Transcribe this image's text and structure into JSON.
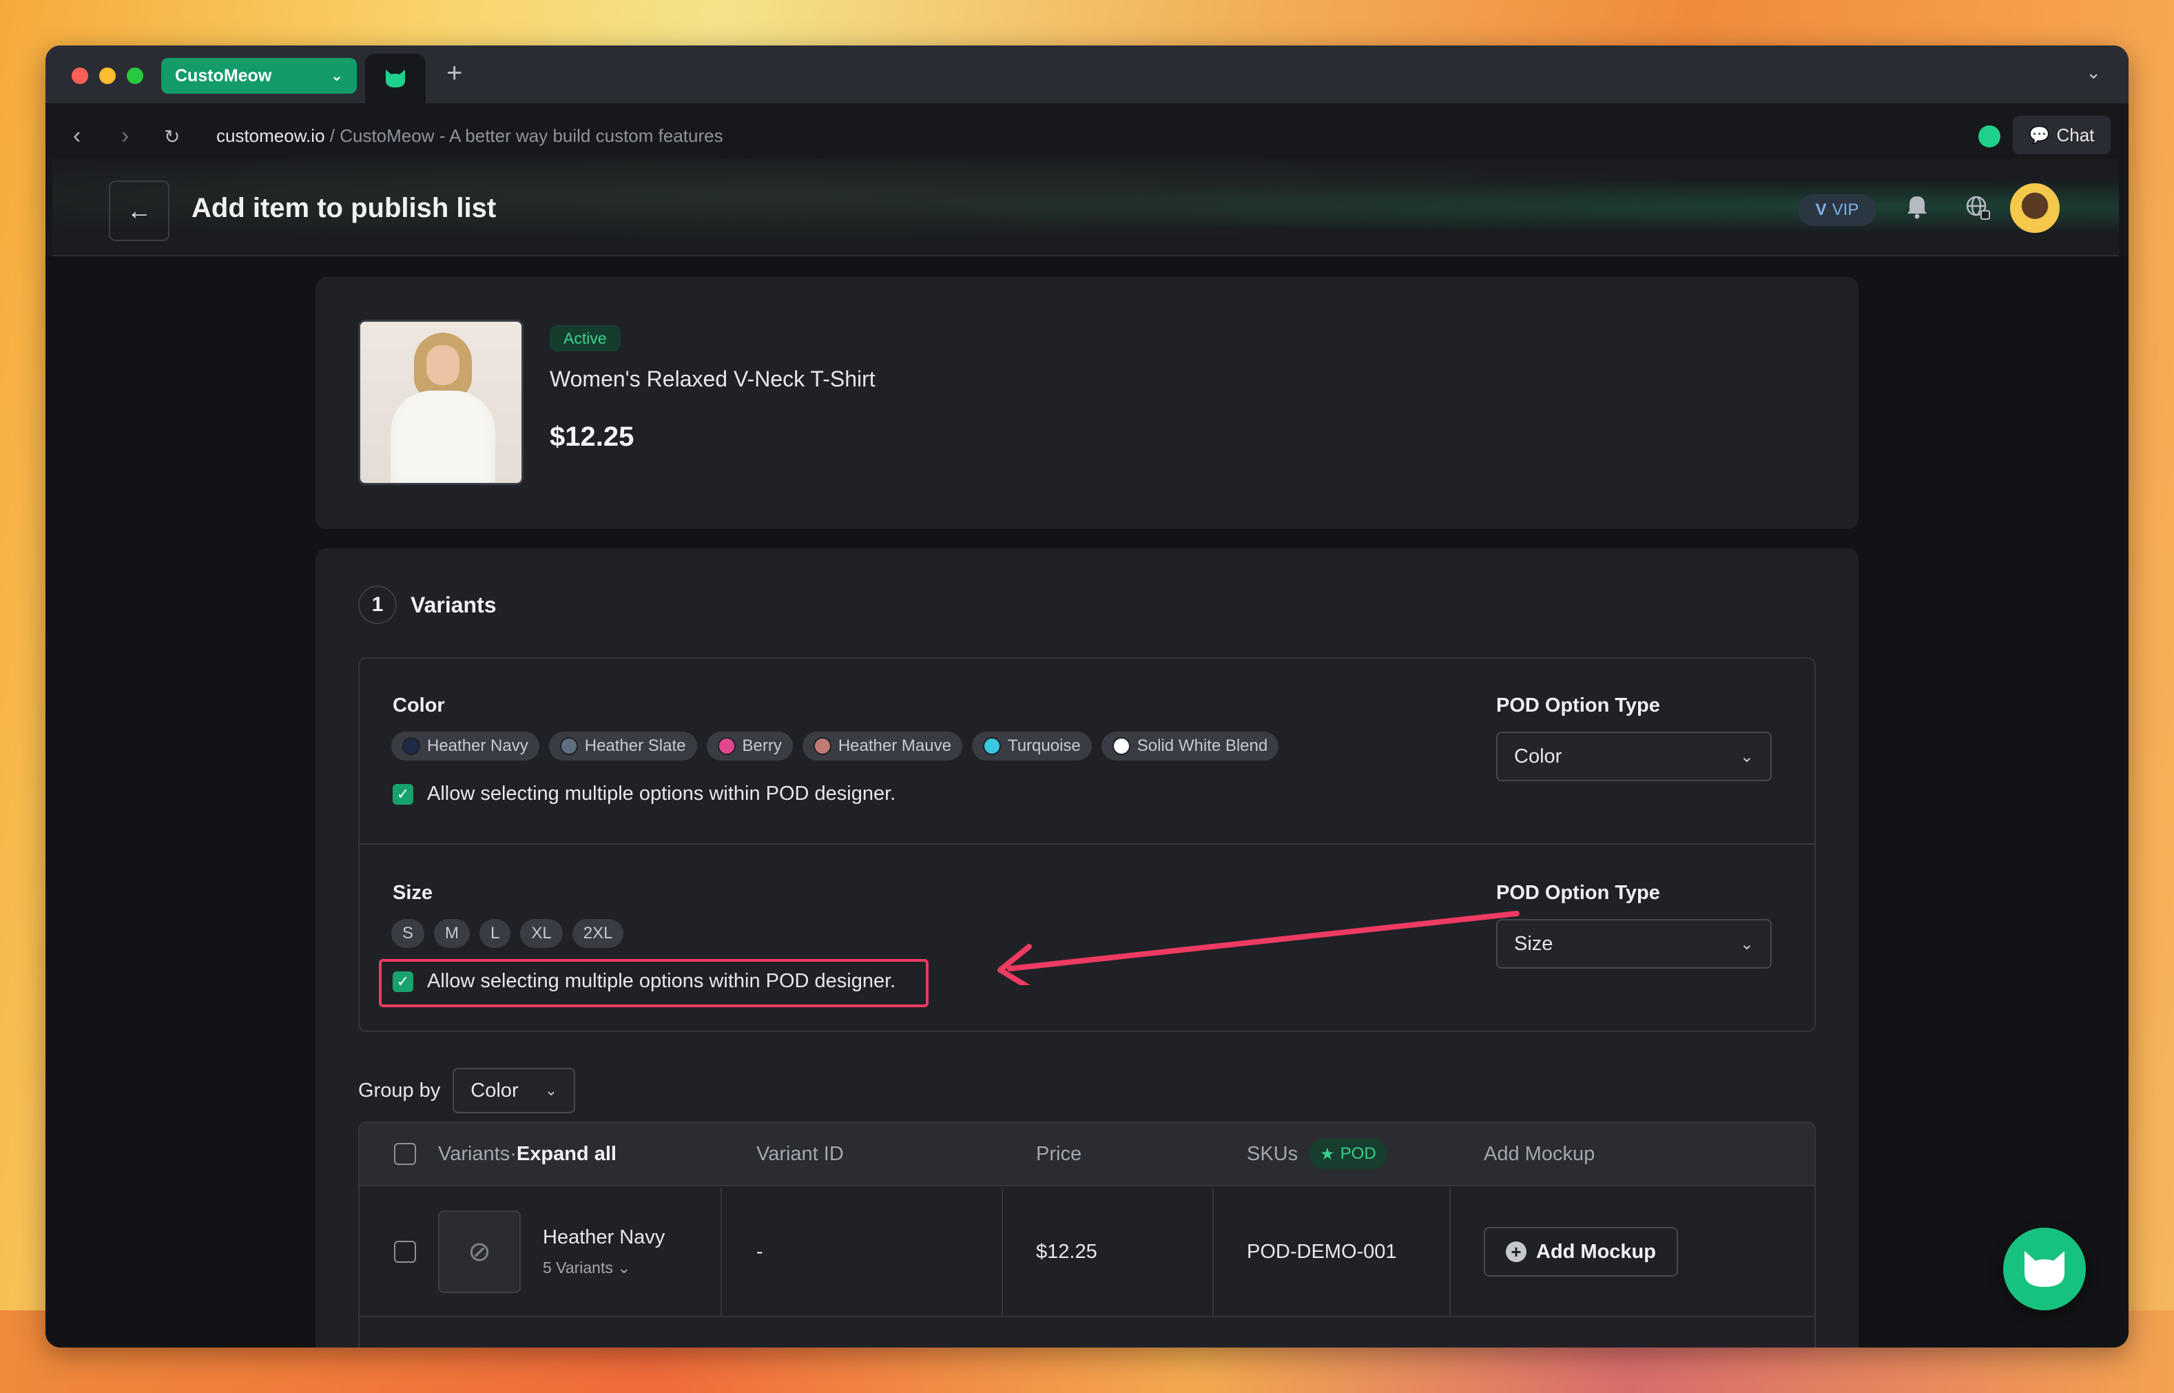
{
  "browser": {
    "workspace": "CustoMeow",
    "new_tab": "+",
    "url_domain": "customeow.io",
    "url_rest": " / CustoMeow - A better way build custom features",
    "chat_label": "Chat"
  },
  "header": {
    "title": "Add item to publish list",
    "vip_label": "VIP"
  },
  "product": {
    "status": "Active",
    "name": "Women's Relaxed V-Neck T-Shirt",
    "price": "$12.25"
  },
  "variants": {
    "step_number": "1",
    "step_label": "Variants",
    "options": [
      {
        "label": "Color",
        "values": [
          {
            "name": "Heather Navy",
            "color": "#1f2a4a"
          },
          {
            "name": "Heather Slate",
            "color": "#5d6f80"
          },
          {
            "name": "Berry",
            "color": "#e0468e"
          },
          {
            "name": "Heather Mauve",
            "color": "#c07a72"
          },
          {
            "name": "Turquoise",
            "color": "#39c8e0"
          },
          {
            "name": "Solid White Blend",
            "color": "#ffffff"
          }
        ],
        "allow_multiple": "Allow selecting multiple options within POD designer.",
        "pod_type_label": "POD Option Type",
        "pod_type_value": "Color"
      },
      {
        "label": "Size",
        "values": [
          {
            "name": "S"
          },
          {
            "name": "M"
          },
          {
            "name": "L"
          },
          {
            "name": "XL"
          },
          {
            "name": "2XL"
          }
        ],
        "allow_multiple": "Allow selecting multiple options within POD designer.",
        "pod_type_label": "POD Option Type",
        "pod_type_value": "Size"
      }
    ],
    "group_by_label": "Group by",
    "group_by_value": "Color"
  },
  "table": {
    "headers": {
      "variants": "Variants",
      "dot": " · ",
      "expand_all": "Expand all",
      "variant_id": "Variant ID",
      "price": "Price",
      "skus": "SKUs",
      "pod_badge": "POD",
      "add_mockup": "Add Mockup"
    },
    "rows": [
      {
        "name": "Heather Navy",
        "sub": "5 Variants",
        "variant_id": "-",
        "price": "$12.25",
        "sku": "POD-DEMO-001",
        "action": "Add Mockup"
      }
    ]
  },
  "colors": {
    "accent": "#18a36d",
    "highlight": "#ee3b62"
  }
}
